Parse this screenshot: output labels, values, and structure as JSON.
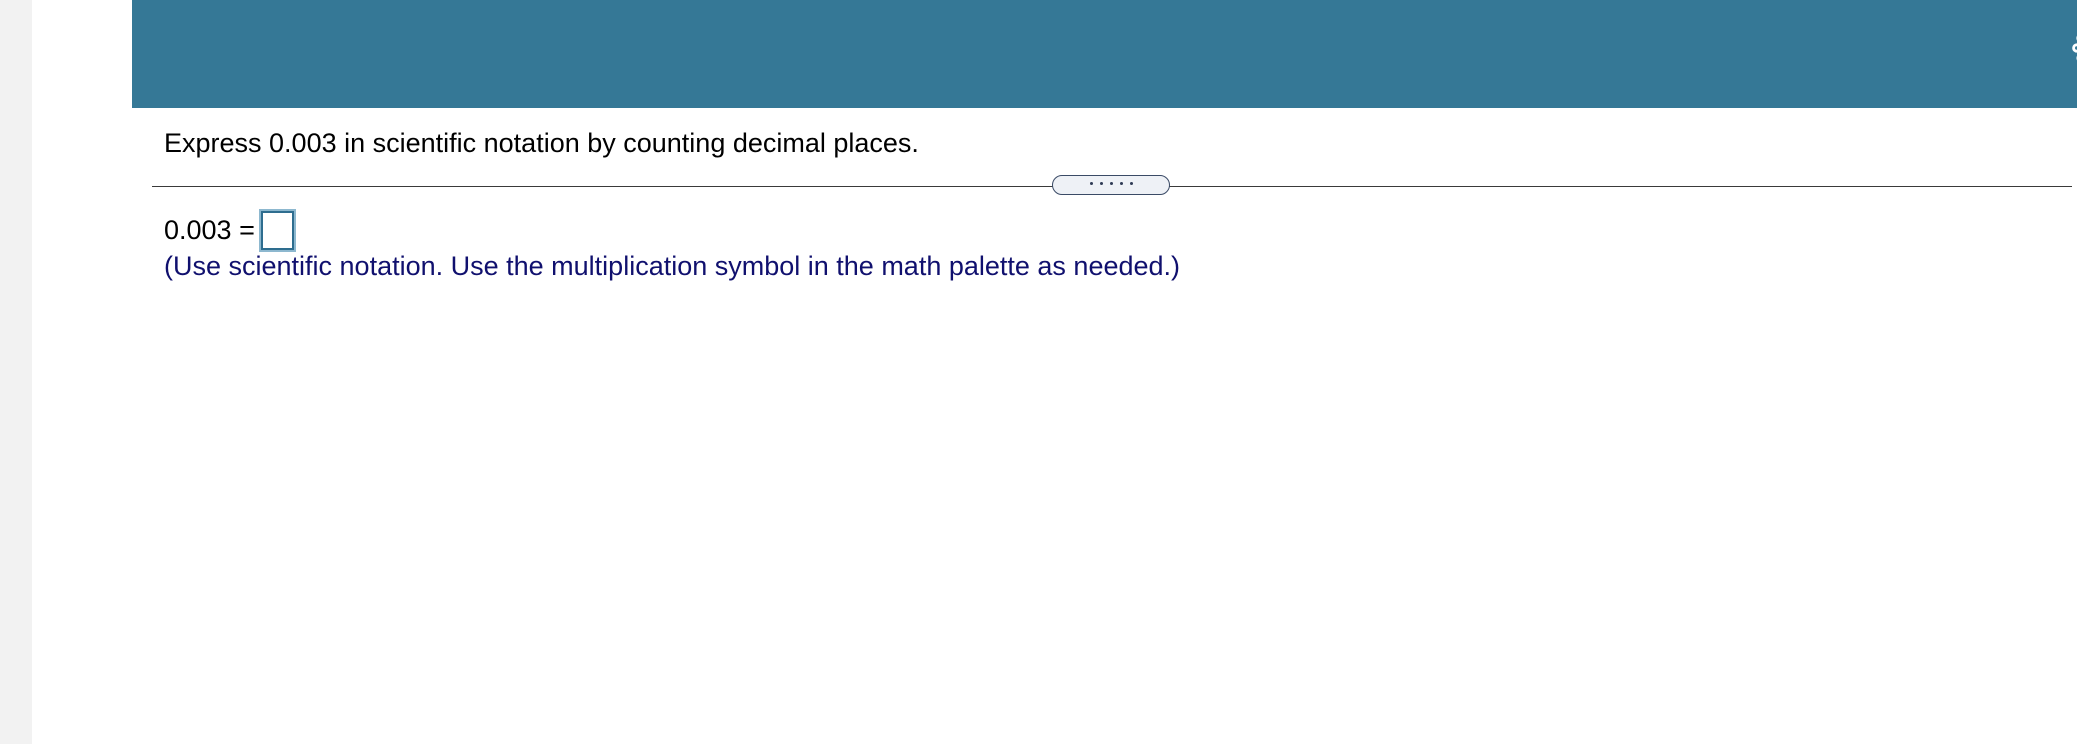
{
  "header": {
    "settings_icon": "gear-icon",
    "background_color": "#357896"
  },
  "question": {
    "prompt": "Express 0.003 in scientific notation by counting decimal places."
  },
  "answer": {
    "equation_label": "0.003 =",
    "input_value": "",
    "instruction": "(Use scientific notation. Use the multiplication symbol in the math palette as needed.)",
    "instruction_color": "#10106e"
  },
  "divider": {
    "handle_icon": "drag-handle-dots-icon"
  }
}
